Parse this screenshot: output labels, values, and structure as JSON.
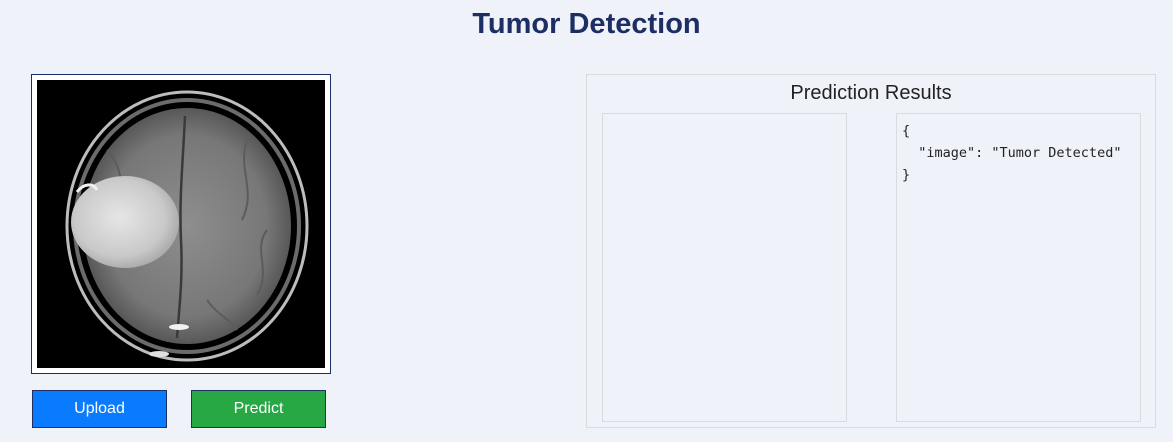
{
  "header": {
    "title": "Tumor Detection"
  },
  "image_panel": {
    "image_description_icon": "mri-brain-scan-image"
  },
  "actions": {
    "upload_label": "Upload",
    "predict_label": "Predict"
  },
  "results": {
    "title": "Prediction Results",
    "json_lines": [
      "{",
      "  \"image\": \"Tumor Detected\"",
      "}"
    ]
  },
  "colors": {
    "title": "#1c2e63",
    "upload": "#0a7bff",
    "predict": "#28a745",
    "background": "#eff2f9"
  }
}
